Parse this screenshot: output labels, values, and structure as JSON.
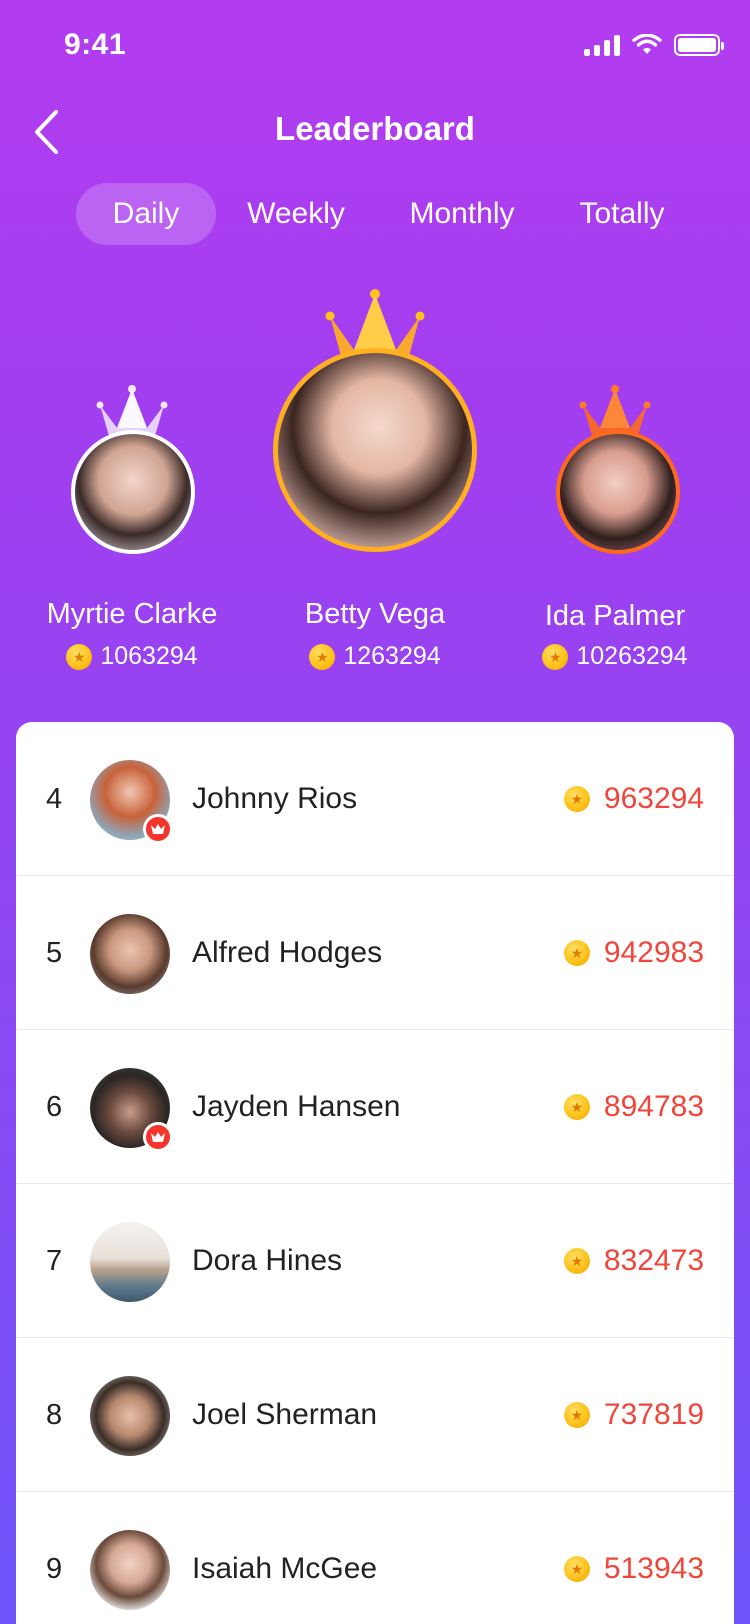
{
  "status_bar": {
    "time": "9:41"
  },
  "header": {
    "title": "Leaderboard",
    "back_icon": "chevron-left-icon"
  },
  "tabs": [
    {
      "label": "Daily",
      "active": true
    },
    {
      "label": "Weekly",
      "active": false
    },
    {
      "label": "Monthly",
      "active": false
    },
    {
      "label": "Totally",
      "active": false
    }
  ],
  "podium": {
    "first": {
      "name": "Betty Vega",
      "score": "1263294",
      "crown_color": "#FFB01F"
    },
    "second": {
      "name": "Myrtie Clarke",
      "score": "1063294",
      "crown_color": "#E9D8FF"
    },
    "third": {
      "name": "Ida Palmer",
      "score": "10263294",
      "crown_color": "#FF6A1A"
    }
  },
  "ranking": [
    {
      "rank": "4",
      "name": "Johnny Rios",
      "score": "963294",
      "vip": true
    },
    {
      "rank": "5",
      "name": "Alfred Hodges",
      "score": "942983",
      "vip": false
    },
    {
      "rank": "6",
      "name": "Jayden Hansen",
      "score": "894783",
      "vip": true
    },
    {
      "rank": "7",
      "name": "Dora Hines",
      "score": "832473",
      "vip": false
    },
    {
      "rank": "8",
      "name": "Joel Sherman",
      "score": "737819",
      "vip": false
    },
    {
      "rank": "9",
      "name": "Isaiah McGee",
      "score": "513943",
      "vip": false
    }
  ],
  "colors": {
    "score_red": "#F0453A",
    "coin_gold": "#FFC21A",
    "vip_badge": "#F5352C"
  },
  "icons": {
    "coin": "coin-icon",
    "vip": "crown-icon"
  }
}
